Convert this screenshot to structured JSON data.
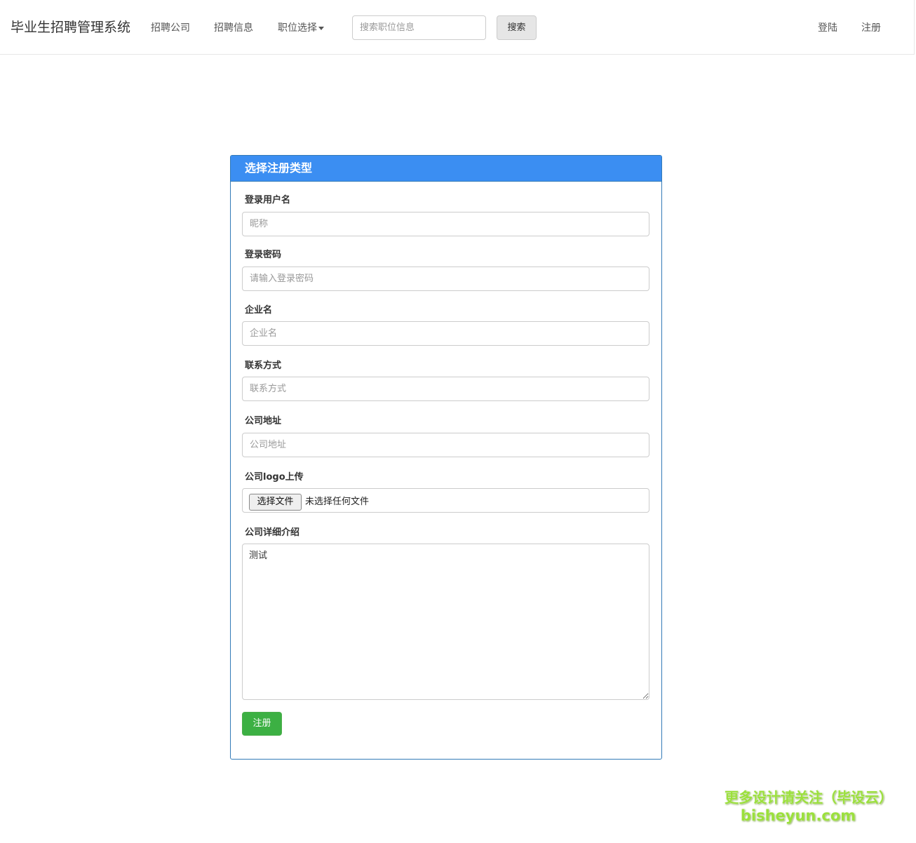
{
  "navbar": {
    "brand": "毕业生招聘管理系统",
    "links": [
      {
        "label": "招聘公司"
      },
      {
        "label": "招聘信息"
      },
      {
        "label": "职位选择"
      }
    ],
    "search": {
      "placeholder": "搜索职位信息",
      "value": "",
      "button_label": "搜索"
    },
    "right_links": [
      {
        "label": "登陆"
      },
      {
        "label": "注册"
      }
    ]
  },
  "panel": {
    "title": "选择注册类型",
    "fields": [
      {
        "label": "登录用户名",
        "placeholder": "昵称",
        "value": ""
      },
      {
        "label": "登录密码",
        "placeholder": "请输入登录密码",
        "value": ""
      },
      {
        "label": "企业名",
        "placeholder": "企业名",
        "value": ""
      },
      {
        "label": "联系方式",
        "placeholder": "联系方式",
        "value": ""
      },
      {
        "label": "公司地址",
        "placeholder": "公司地址",
        "value": ""
      }
    ],
    "logo_upload": {
      "label": "公司logo上传",
      "button_label": "选择文件",
      "status": "未选择任何文件"
    },
    "description": {
      "label": "公司详细介绍",
      "value": "测试"
    },
    "submit_label": "注册"
  },
  "watermark": {
    "line1": "更多设计请关注（毕设云）",
    "line2": "bisheyun.com"
  }
}
